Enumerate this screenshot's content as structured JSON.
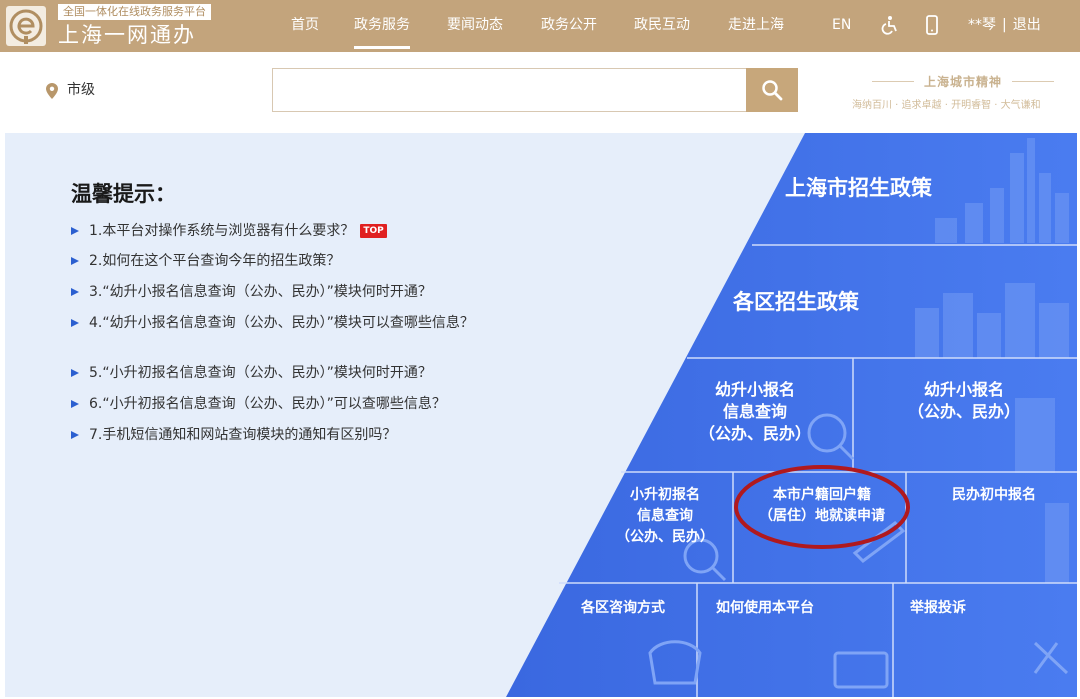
{
  "header": {
    "logo_sub": "全国一体化在线政务服务平台",
    "logo_main": "上海一网通办",
    "nav": [
      {
        "label": "首页"
      },
      {
        "label": "政务服务"
      },
      {
        "label": "要闻动态"
      },
      {
        "label": "政务公开"
      },
      {
        "label": "政民互动"
      },
      {
        "label": "走进上海"
      },
      {
        "label": "EN"
      }
    ],
    "active_nav": "政务服务",
    "user_name": "**琴",
    "logout": "退出",
    "accent": "#c3a47c"
  },
  "search": {
    "location": "市级",
    "placeholder": "",
    "value": ""
  },
  "spirit": {
    "title": "上海城市精神",
    "words": "海纳百川 · 追求卓越 · 开明睿智 · 大气谦和"
  },
  "tips": {
    "title": "温馨提示：",
    "badge": "TOP",
    "items": [
      "1.本平台对操作系统与浏览器有什么要求？",
      "2.如何在这个平台查询今年的招生政策？",
      "3.“幼升小报名信息查询（公办、民办）”模块何时开通？",
      "4.“幼升小报名信息查询（公办、民办）”模块可以查哪些信息？",
      "5.“小升初报名信息查询（公办、民办）”模块何时开通？",
      "6.“小升初报名信息查询（公办、民办）”可以查哪些信息？",
      "7.手机短信通知和网站查询模块的通知有区别吗？"
    ]
  },
  "tiles": {
    "city_policy": "上海市招生政策",
    "district_policy": "各区招生政策",
    "k1_query": [
      "幼升小报名",
      "信息查询",
      "（公办、民办）"
    ],
    "k1_register": [
      "幼升小报名",
      "（公办、民办）"
    ],
    "p6_query": [
      "小升初报名",
      "信息查询",
      "（公办、民办）"
    ],
    "hukou_apply": [
      "本市户籍回户籍",
      "（居住）地就读申请"
    ],
    "private_middle": "民办初中报名",
    "contact": "各区咨询方式",
    "howto": "如何使用本平台",
    "report": "举报投诉"
  },
  "colors": {
    "panel_bg": "#e6eefa",
    "tile_blue": "#3d6fe6",
    "highlight_ring": "#b0191e"
  }
}
